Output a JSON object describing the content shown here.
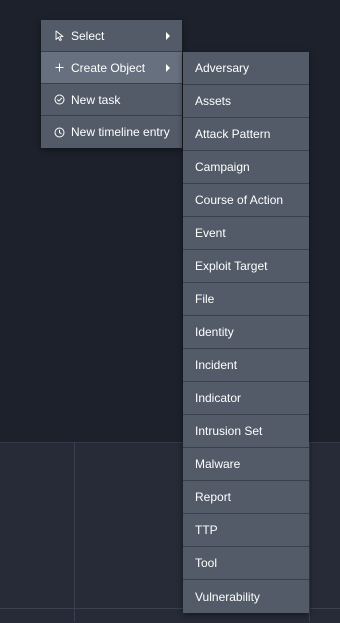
{
  "context_menu": {
    "items": [
      {
        "label": "Select",
        "icon": "cursor-icon",
        "has_submenu": true
      },
      {
        "label": "Create Object",
        "icon": "plus-icon",
        "has_submenu": true,
        "active": true
      },
      {
        "label": "New task",
        "icon": "check-circle-icon",
        "has_submenu": false
      },
      {
        "label": "New timeline entry",
        "icon": "clock-icon",
        "has_submenu": false
      }
    ]
  },
  "create_object_submenu": {
    "items": [
      "Adversary",
      "Assets",
      "Attack Pattern",
      "Campaign",
      "Course of Action",
      "Event",
      "Exploit Target",
      "File",
      "Identity",
      "Incident",
      "Indicator",
      "Intrusion Set",
      "Malware",
      "Report",
      "TTP",
      "Tool",
      "Vulnerability"
    ]
  },
  "colors": {
    "background": "#1d212b",
    "menu_bg": "#535b68",
    "menu_active": "#67707e",
    "text": "#ffffff"
  }
}
